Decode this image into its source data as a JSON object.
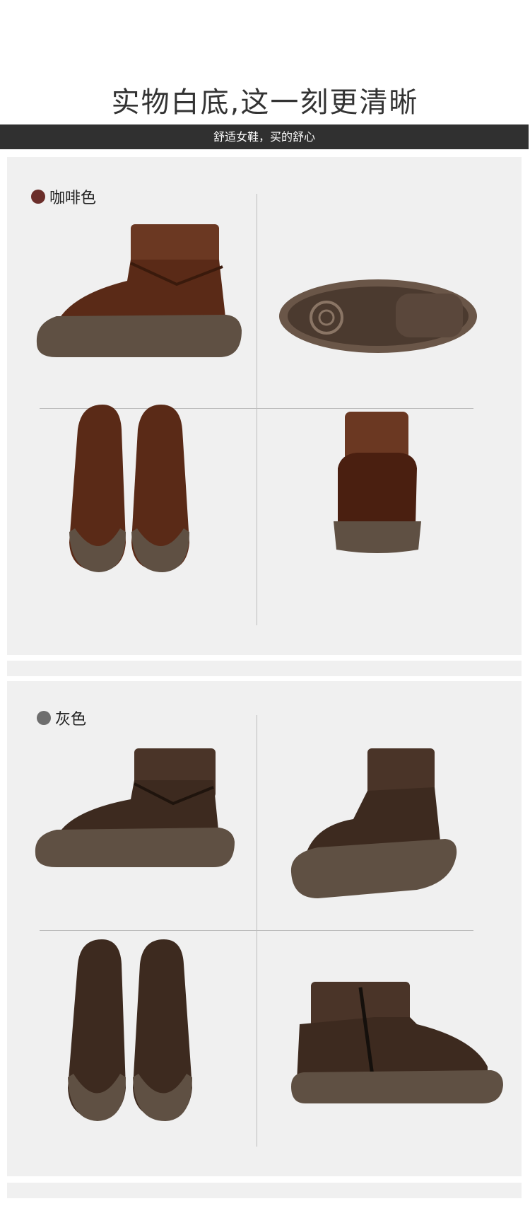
{
  "header": {
    "title": "实物白底,这一刻更清晰",
    "subtitle": "舒适女鞋，买的舒心"
  },
  "sections": [
    {
      "label": "咖啡色",
      "dot_color": "#6b2e2a",
      "upper_color": "#5a2a17",
      "collar_color": "#6b3822"
    },
    {
      "label": "灰色",
      "dot_color": "#6e6e6e",
      "upper_color": "#3d2a1f",
      "collar_color": "#4a3428"
    }
  ],
  "colors": {
    "sole": "#5f5043",
    "panel_bg": "#f0f0f0",
    "bar_bg": "#303030"
  }
}
